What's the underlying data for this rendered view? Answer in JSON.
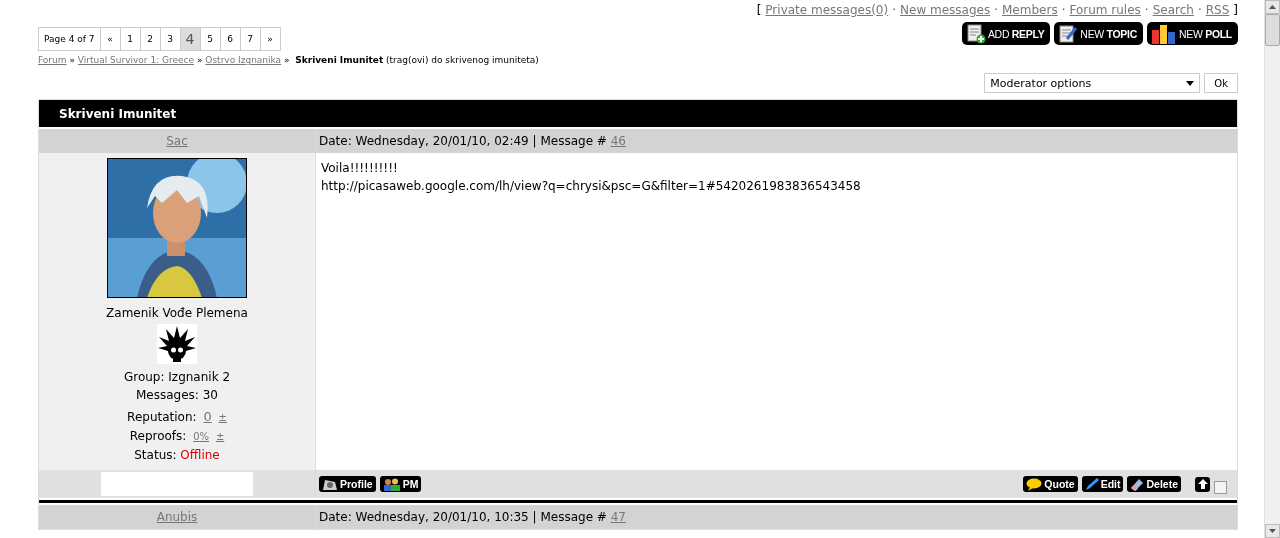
{
  "top_links": {
    "open": "[",
    "separator": "·",
    "close": "]",
    "links": [
      "Private messages(0)",
      "New messages",
      "Members",
      "Forum rules",
      "Search",
      "RSS"
    ]
  },
  "pagination": {
    "label": "Page 4 of 7",
    "items": [
      {
        "text": "«",
        "selected": false
      },
      {
        "text": "1",
        "selected": false
      },
      {
        "text": "2",
        "selected": false
      },
      {
        "text": "3",
        "selected": false
      },
      {
        "text": "4",
        "selected": true
      },
      {
        "text": "5",
        "selected": false
      },
      {
        "text": "6",
        "selected": false
      },
      {
        "text": "7",
        "selected": false
      },
      {
        "text": "»",
        "selected": false
      }
    ]
  },
  "action_buttons": [
    {
      "kind": "reply",
      "label": "ADD **REPLY**"
    },
    {
      "kind": "topic",
      "label": "NEW **TOPIC**"
    },
    {
      "kind": "poll",
      "label": "NEW **POLL**"
    }
  ],
  "breadcrumb": {
    "separator": "»",
    "links": [
      "Forum",
      "Virtual Survivor 1: Greece",
      "Ostrvo Izgnanika"
    ],
    "current": "Skriveni Imunitet",
    "note": "(trag(ovi) do skrivenog imuniteta)"
  },
  "moderator": {
    "value": "Moderator options",
    "button": "Ok"
  },
  "topic_title": "Skriveni Imunitet",
  "posts": [
    {
      "author": "Sac",
      "date": "Date: Wednesday, 20/01/10, 02:49 | Message #",
      "number": "46",
      "rank": "Zamenik Vođe Plemena",
      "group": "Group: Izgnanik 2",
      "messages": "Messages: 30",
      "reputation_label": "Reputation:",
      "reputation": "0",
      "reproofs_label": "Reproofs:",
      "reproofs": "0%",
      "plusminus": "±",
      "status_label": "Status:",
      "status": "Offline",
      "online": false,
      "body": [
        "Voila!!!!!!!!!!",
        "http://picasaweb.google.com/lh/view?q=chrysi&psc=G&filter=1#5420261983836543458"
      ],
      "user_buttons": [
        {
          "kind": "profile",
          "label": "Profile"
        },
        {
          "kind": "pm",
          "label": "PM"
        }
      ],
      "post_buttons": [
        {
          "kind": "quote",
          "label": "Quote"
        },
        {
          "kind": "edit",
          "label": "Edit"
        },
        {
          "kind": "delete",
          "label": "Delete"
        }
      ],
      "selected": false
    },
    {
      "author": "Anubis",
      "date": "Date: Wednesday, 20/01/10, 10:35 | Message #",
      "number": "47"
    }
  ]
}
